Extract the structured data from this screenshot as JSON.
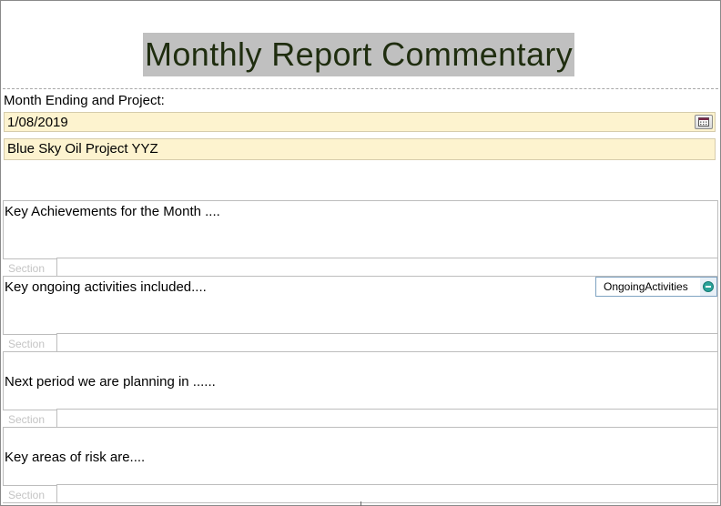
{
  "title": "Monthly Report Commentary",
  "month_label": "Month Ending and Project:",
  "date_value": "1/08/2019",
  "project_value": "Blue Sky Oil Project YYZ",
  "section_tag": "Section",
  "sections": [
    {
      "text": "Key Achievements for the Month ...."
    },
    {
      "text": "Key ongoing activities included....",
      "control_label": "OngoingActivities"
    },
    {
      "text": "Next period we are planning in ......"
    },
    {
      "text": "Key areas of risk are...."
    }
  ],
  "colors": {
    "title_bg": "#c0c0c0",
    "title_text": "#1f2d0f",
    "field_bg": "#fdf3cf",
    "control_accent": "#2aa39a"
  },
  "icons": [
    "calendar-icon",
    "minus-circle-icon"
  ]
}
